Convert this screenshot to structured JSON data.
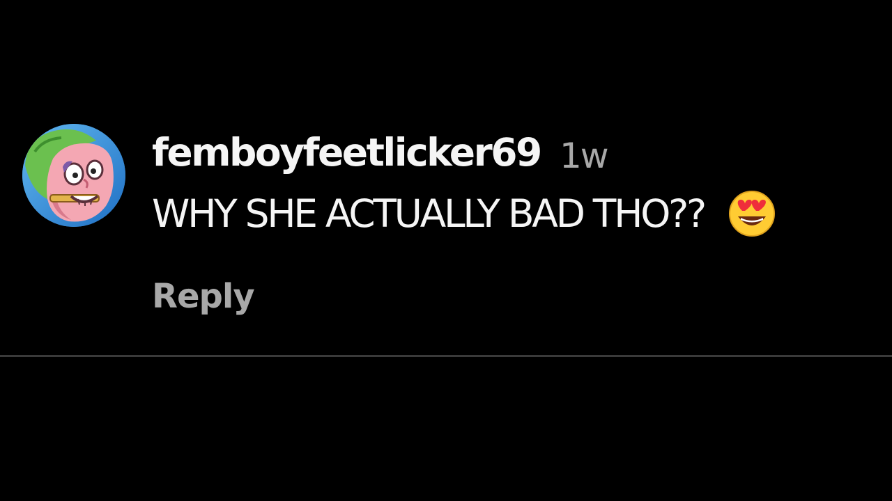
{
  "comment": {
    "username": "femboyfeetlicker69",
    "timestamp": "1w",
    "text": "WHY SHE ACTUALLY BAD THO??",
    "emoji": "smiling-face-with-heart-eyes",
    "reply_label": "Reply",
    "avatar": "cartoon-character-avatar"
  },
  "colors": {
    "background": "#000000",
    "primary_text": "#f5f5f5",
    "secondary_text": "#a8a8a8",
    "divider": "#3a3a3a"
  }
}
